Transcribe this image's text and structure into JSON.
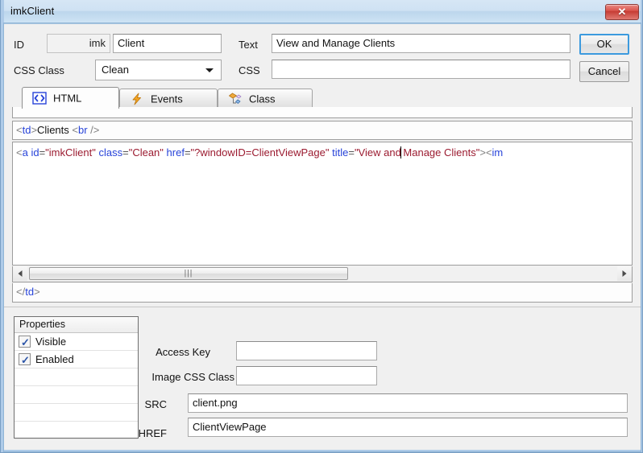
{
  "window": {
    "title": "imkClient",
    "close_label": "✕",
    "close_icon": "close-icon"
  },
  "form": {
    "id_label": "ID",
    "id_prefix": "imk",
    "id_value": "Client",
    "css_class_label": "CSS Class",
    "css_class_value": "Clean",
    "text_label": "Text",
    "text_value": "View and Manage Clients",
    "css_label": "CSS",
    "css_value": "",
    "ok_label": "OK",
    "cancel_label": "Cancel"
  },
  "tabs": [
    {
      "label": "HTML",
      "icon": "code-brackets-icon",
      "active": true
    },
    {
      "label": "Events",
      "icon": "lightning-bolt-icon",
      "active": false
    },
    {
      "label": "Class",
      "icon": "diamonds-icon",
      "active": false
    }
  ],
  "editor": {
    "line_above": "<td>Clients <br />",
    "line_below": "</td>",
    "code_tokens": [
      {
        "t": "<",
        "c": "br"
      },
      {
        "t": "a",
        "c": "tag"
      },
      {
        "t": " ",
        "c": "text"
      },
      {
        "t": "id",
        "c": "attr"
      },
      {
        "t": "=",
        "c": "eq"
      },
      {
        "t": "\"imkClient\"",
        "c": "val"
      },
      {
        "t": " ",
        "c": "text"
      },
      {
        "t": "class",
        "c": "attr"
      },
      {
        "t": "=",
        "c": "eq"
      },
      {
        "t": "\"Clean\"",
        "c": "val"
      },
      {
        "t": " ",
        "c": "text"
      },
      {
        "t": "href",
        "c": "attr"
      },
      {
        "t": "=",
        "c": "eq"
      },
      {
        "t": "\"?windowID=ClientViewPage\"",
        "c": "val"
      },
      {
        "t": " ",
        "c": "text"
      },
      {
        "t": "title",
        "c": "attr"
      },
      {
        "t": "=",
        "c": "eq"
      },
      {
        "t": "\"View and",
        "c": "val"
      },
      {
        "t": "CARET",
        "c": "caret"
      },
      {
        "t": " Manage Clients\"",
        "c": "val"
      },
      {
        "t": ">",
        "c": "br"
      },
      {
        "t": "<",
        "c": "br"
      },
      {
        "t": "im",
        "c": "tag"
      }
    ],
    "scrollbar": {
      "left_arrow": "◀",
      "right_arrow": "▶",
      "grip": "⫿e"
    }
  },
  "properties": {
    "header": "Properties",
    "rows": [
      {
        "name": "Visible",
        "checked": true
      },
      {
        "name": "Enabled",
        "checked": true
      },
      {
        "name": "",
        "checked": false
      },
      {
        "name": "",
        "checked": false
      },
      {
        "name": "",
        "checked": false
      },
      {
        "name": "",
        "checked": false
      },
      {
        "name": "",
        "checked": false
      }
    ],
    "check_glyph": "✓"
  },
  "fields": {
    "access_key_label": "Access Key",
    "access_key_value": "",
    "image_css_class_label": "Image CSS Class",
    "image_css_class_value": "",
    "src_label": "SRC",
    "src_value": "client.png",
    "href_label": "HREF",
    "href_value": "ClientViewPage"
  },
  "colors": {
    "titlebar": "#cfe2f3",
    "close_red": "#c53b33",
    "focus_blue": "#3c9ade",
    "tag_blue": "#2743d9",
    "value_red": "#9b1b30",
    "bracket_grey": "#808080"
  }
}
